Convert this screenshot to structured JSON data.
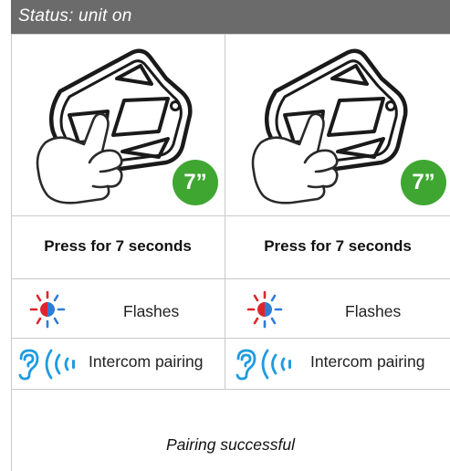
{
  "header": {
    "status_text": "Status: unit on"
  },
  "columns": [
    {
      "duration_badge": "7”",
      "press_instruction": "Press for 7 seconds",
      "led_label": "Flashes",
      "pairing_label": "Intercom pairing"
    },
    {
      "duration_badge": "7”",
      "press_instruction": "Press for 7 seconds",
      "led_label": "Flashes",
      "pairing_label": "Intercom pairing"
    }
  ],
  "footer": {
    "result_text": "Pairing successful"
  },
  "colors": {
    "header_bg": "#6b6b6b",
    "badge_green": "#3fa632",
    "led_red": "#e0242b",
    "led_blue": "#2e7cd6",
    "ear_blue": "#1e9be0"
  },
  "icons": {
    "device": "button-remote-icon",
    "hand": "pointing-hand-icon",
    "led": "red-blue-led-flash-icon",
    "ear": "ear-icon",
    "signal": "intercom-signal-icon"
  }
}
